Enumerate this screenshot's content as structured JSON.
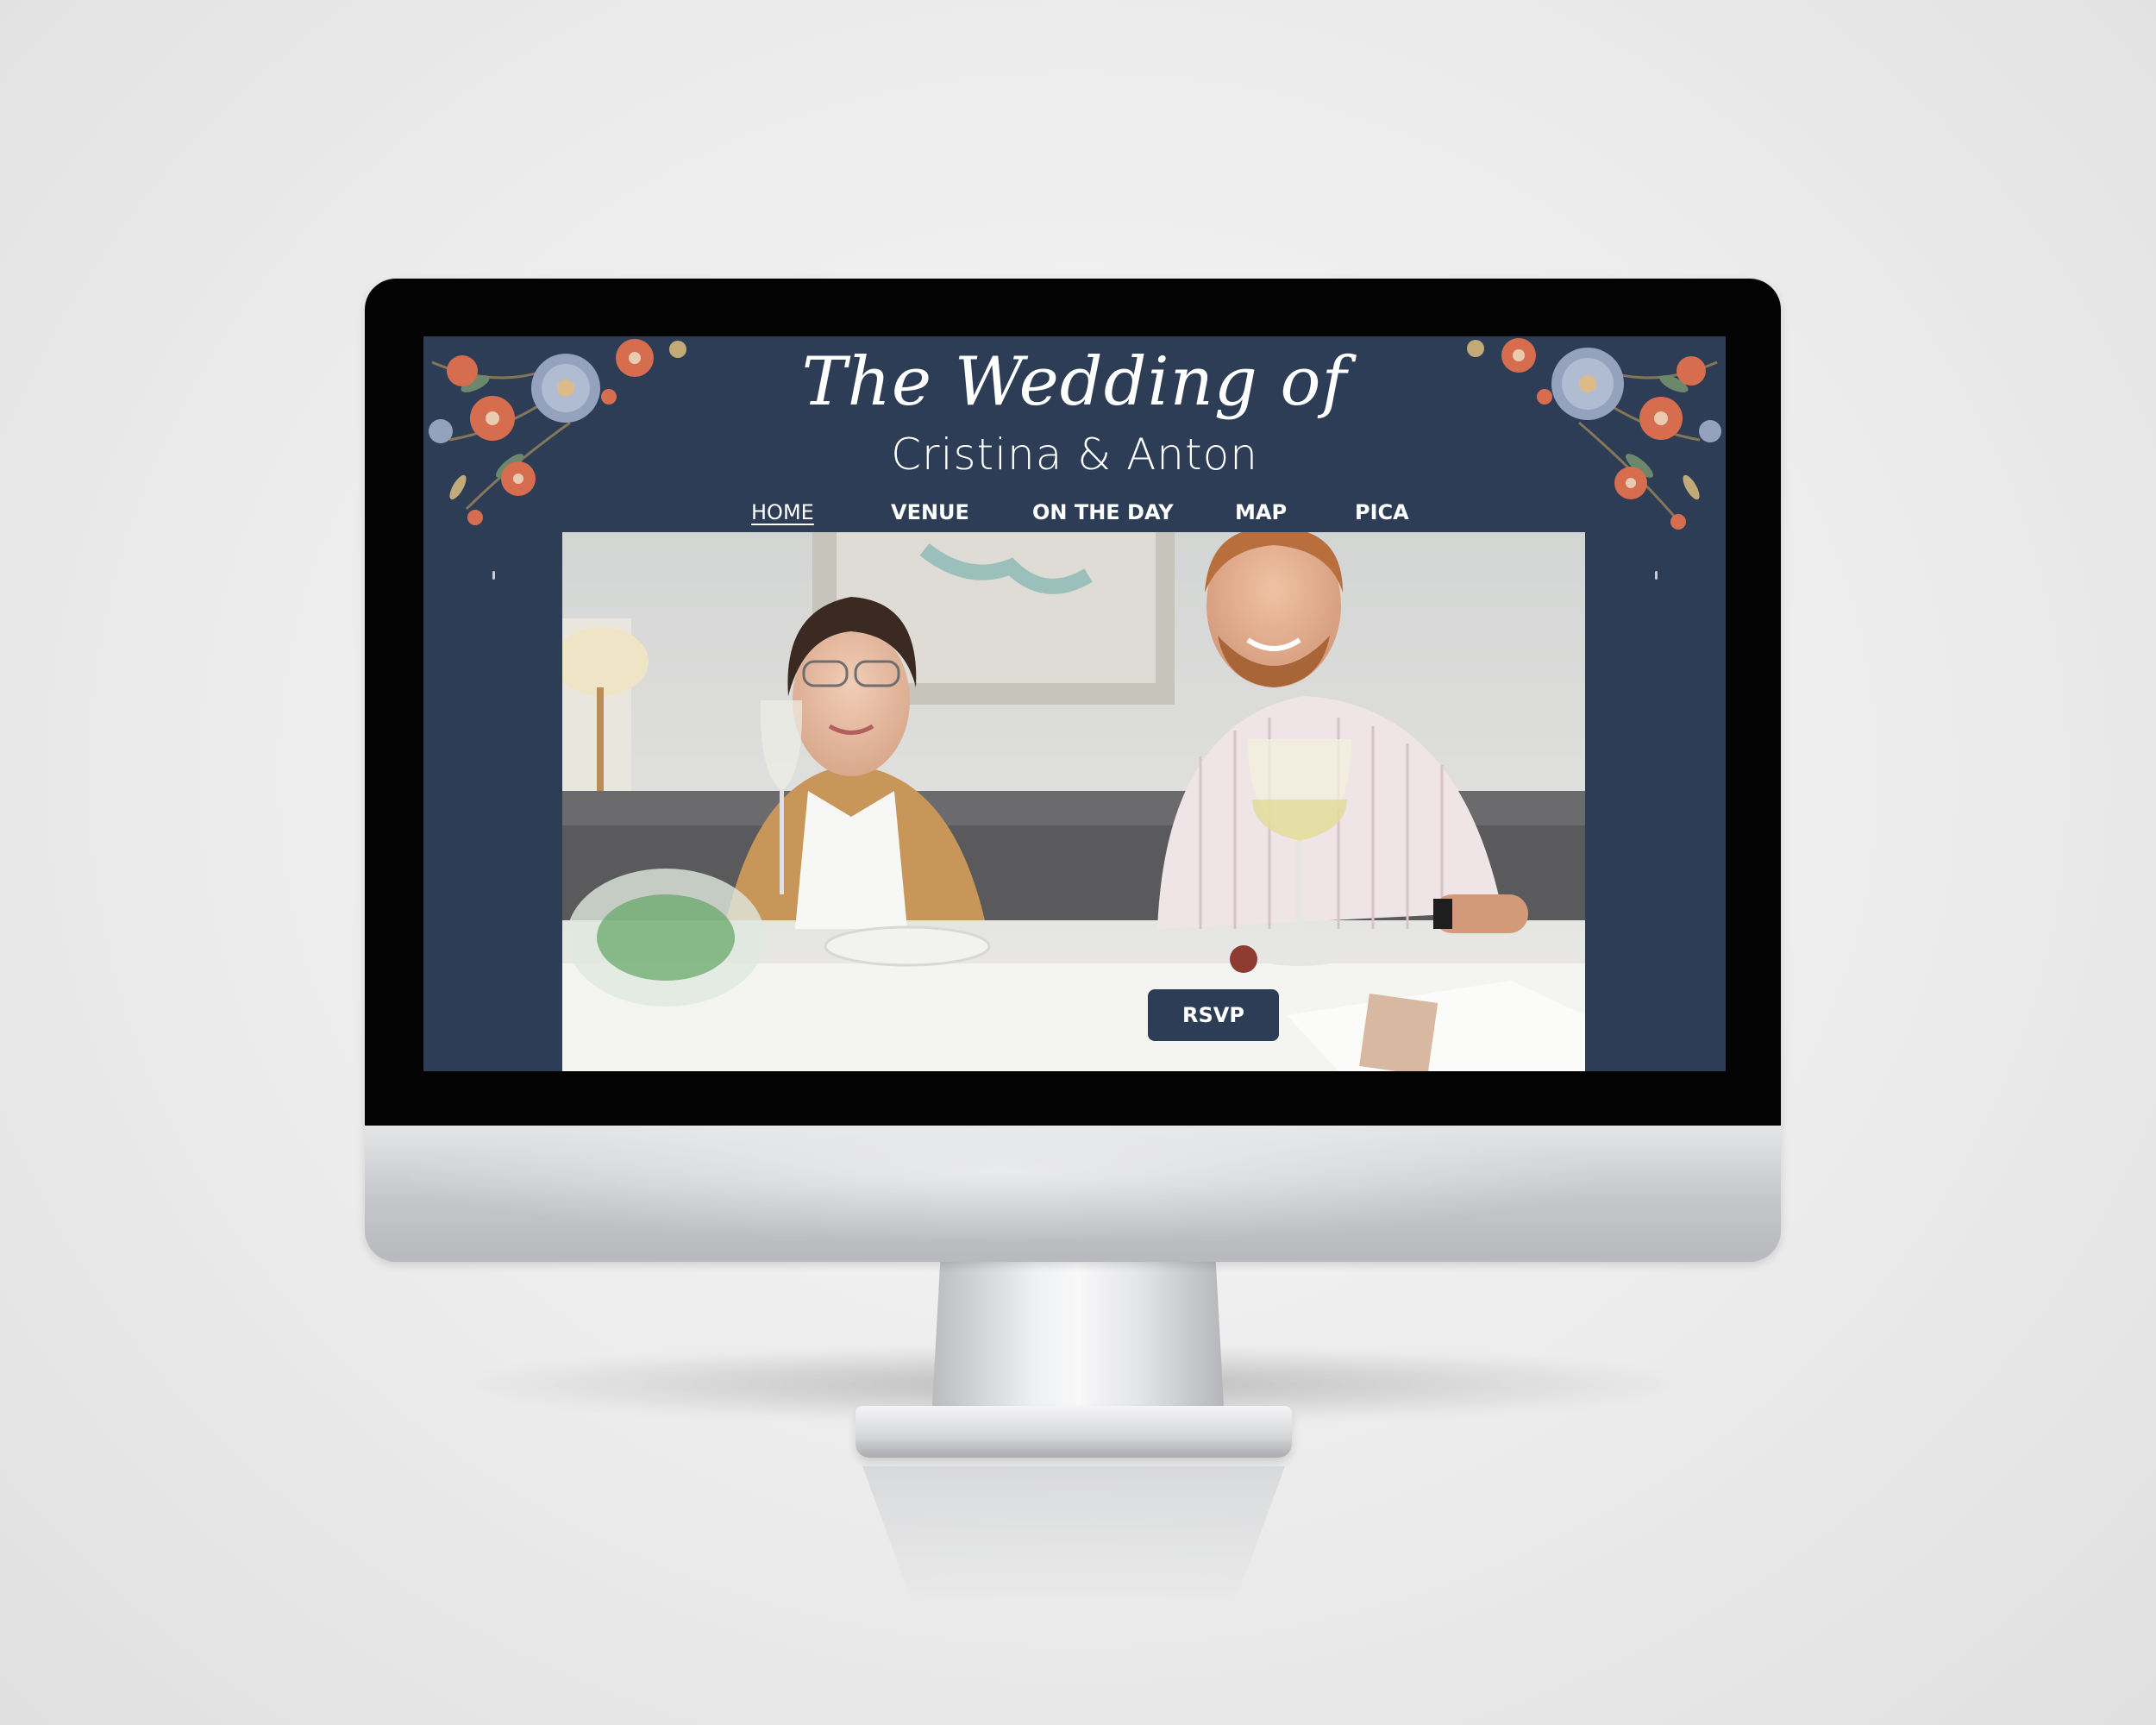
{
  "site": {
    "title_script": "The Wedding of",
    "couple_names": "Cristina & Anton"
  },
  "nav": {
    "items": [
      {
        "label": "HOME",
        "active": true
      },
      {
        "label": "VENUE",
        "active": false
      },
      {
        "label": "ON THE DAY",
        "active": false
      },
      {
        "label": "MAP",
        "active": false
      },
      {
        "label": "PICA",
        "active": false
      }
    ]
  },
  "hero": {
    "rsvp_label": "RSVP"
  },
  "colors": {
    "page_background": "#2e3d56",
    "button_background": "#2e3d56",
    "text": "#ffffff",
    "floral_accent": "#e0704f"
  },
  "icons": {
    "floral_left": "floral-corner-icon",
    "floral_right": "floral-corner-icon"
  }
}
